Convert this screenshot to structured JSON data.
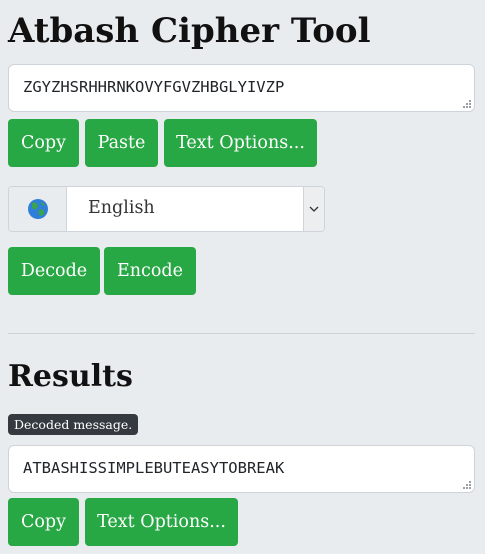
{
  "page": {
    "title": "Atbash Cipher Tool"
  },
  "input": {
    "value": "ZGYZHSRHHRNKOVYFGVZHBGLYIVZP"
  },
  "input_buttons": {
    "copy": "Copy",
    "paste": "Paste",
    "text_options": "Text Options..."
  },
  "language": {
    "icon": "globe-icon",
    "selected": "English"
  },
  "actions": {
    "decode": "Decode",
    "encode": "Encode"
  },
  "results": {
    "heading": "Results",
    "badge": "Decoded message.",
    "value": "ATBASHISSIMPLEBUTEASYTOBREAK",
    "copy": "Copy",
    "text_options": "Text Options..."
  },
  "colors": {
    "accent": "#28a745",
    "badge": "#343a40",
    "background": "#e9ecef"
  }
}
